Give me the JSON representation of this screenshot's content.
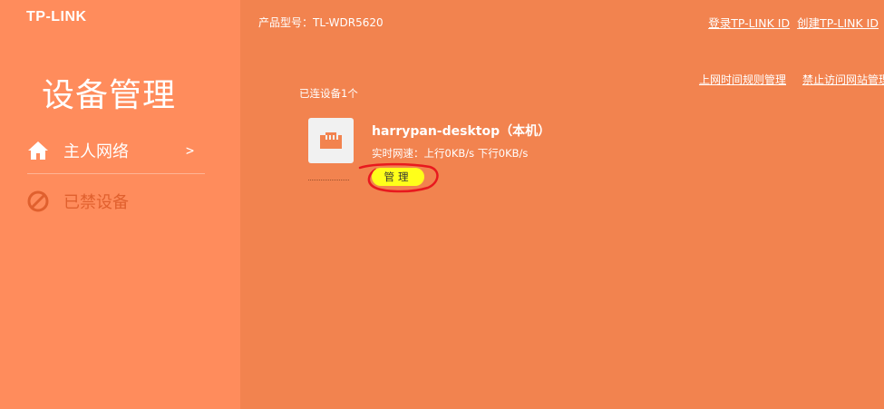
{
  "brand": {
    "logo": "TP-LINK"
  },
  "sidebar": {
    "title": "设备管理",
    "items": [
      {
        "label": "主人网络",
        "icon": "home-icon",
        "chevron": ">"
      },
      {
        "label": "已禁设备",
        "icon": "forbidden-icon"
      }
    ]
  },
  "header": {
    "model": "产品型号：TL-WDR5620",
    "links": [
      "登录TP-LINK ID",
      "创建TP-LINK ID"
    ]
  },
  "main": {
    "sub_links": [
      "上网时间规则管理",
      "禁止访问网站管理"
    ],
    "device_count": "已连设备1个",
    "device": {
      "icon": "ethernet-port-icon",
      "name": "harrypan-desktop（本机）",
      "speed": "实时网速：上行0KB/s 下行0KB/s",
      "manage_label": "管理"
    }
  },
  "colors": {
    "background": "#f2834f",
    "sidebar": "#ff8c5c",
    "blocked_text": "#e0602e",
    "manage_button": "#ffff1a",
    "annotation": "#e8191e"
  }
}
